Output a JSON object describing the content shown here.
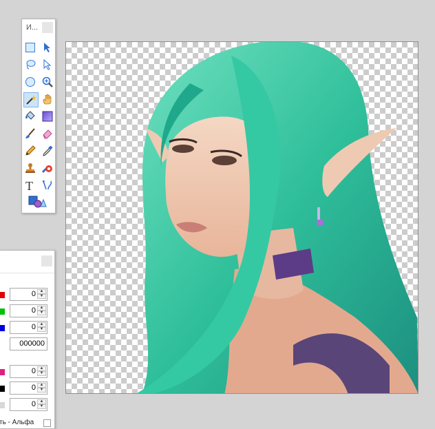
{
  "tools_window": {
    "title": "И...",
    "tools": [
      "rectangle-select-icon",
      "move-selection-icon",
      "lasso-select-icon",
      "move-selected-icon",
      "ellipse-select-icon",
      "zoom-icon",
      "magic-wand-icon",
      "pan-hand-icon",
      "paint-bucket-icon",
      "gradient-icon",
      "paintbrush-icon",
      "eraser-icon",
      "pencil-icon",
      "color-picker-icon",
      "clone-stamp-icon",
      "recolor-icon",
      "text-icon",
      "line-curve-icon",
      "shapes-icon"
    ],
    "selected": "magic-wand-icon"
  },
  "colors_window": {
    "rgb_fields": [
      {
        "channel": "red",
        "color": "#e00000",
        "value": "0"
      },
      {
        "channel": "green",
        "color": "#00c000",
        "value": "0"
      },
      {
        "channel": "blue",
        "color": "#0000e0",
        "value": "0"
      }
    ],
    "hex_value": "000000",
    "hsv_fields": [
      {
        "channel": "hue",
        "color": "#e0207a",
        "value": "0"
      },
      {
        "channel": "saturation",
        "color": "#000000",
        "value": "0"
      },
      {
        "channel": "value",
        "color": "#d8d8d8",
        "value": "0"
      }
    ],
    "alpha_label": "ть - Альфа"
  },
  "canvas": {
    "background": "transparent-checkerboard",
    "image": "elf-girl-with-teal-hair"
  }
}
